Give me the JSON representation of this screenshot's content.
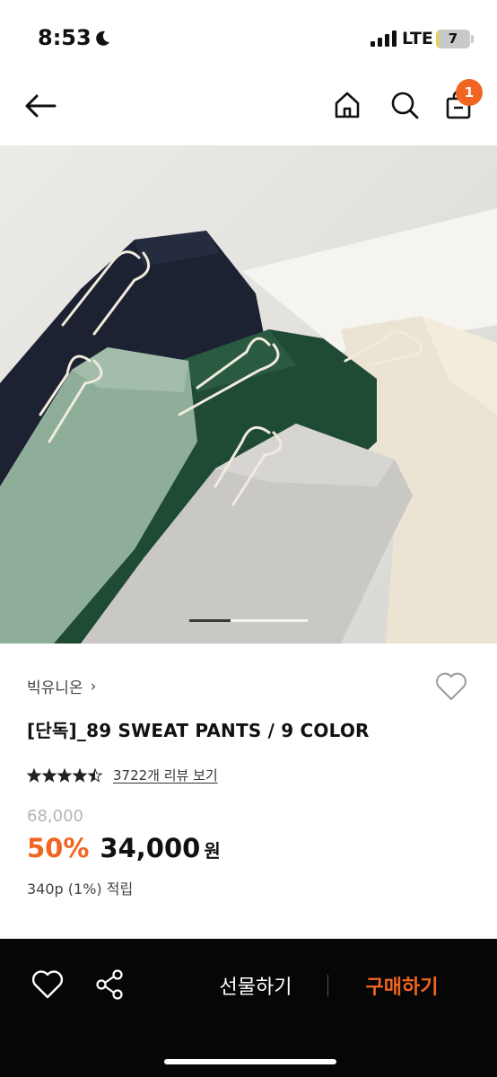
{
  "status_bar": {
    "time": "8:53",
    "network": "LTE",
    "battery_level": "7",
    "battery_fraction": 0.07
  },
  "header": {
    "cart_count": "1"
  },
  "gallery": {
    "carousel_progress": 0.35
  },
  "product": {
    "brand": "빅유니온",
    "brand_chevron": "›",
    "title": "[단독]_89 SWEAT PANTS / 9 COLOR",
    "rating": 4.5,
    "review_link": "3722개 리뷰 보기",
    "original_price": "68,000",
    "discount": "50%",
    "sale_price": "34,000",
    "currency": "원",
    "points": "340p (1%) 적립"
  },
  "bottom_bar": {
    "gift_label": "선물하기",
    "buy_label": "구매하기"
  },
  "icons": {
    "back": "arrow-left-icon",
    "home": "home-icon",
    "search": "search-icon",
    "cart": "shopping-bag-icon",
    "wish": "heart-icon",
    "share": "share-icon",
    "status_moon": "moon-icon"
  },
  "colors": {
    "accent": "#f16522",
    "bottom_bar": "#060606",
    "star": "#222222"
  }
}
